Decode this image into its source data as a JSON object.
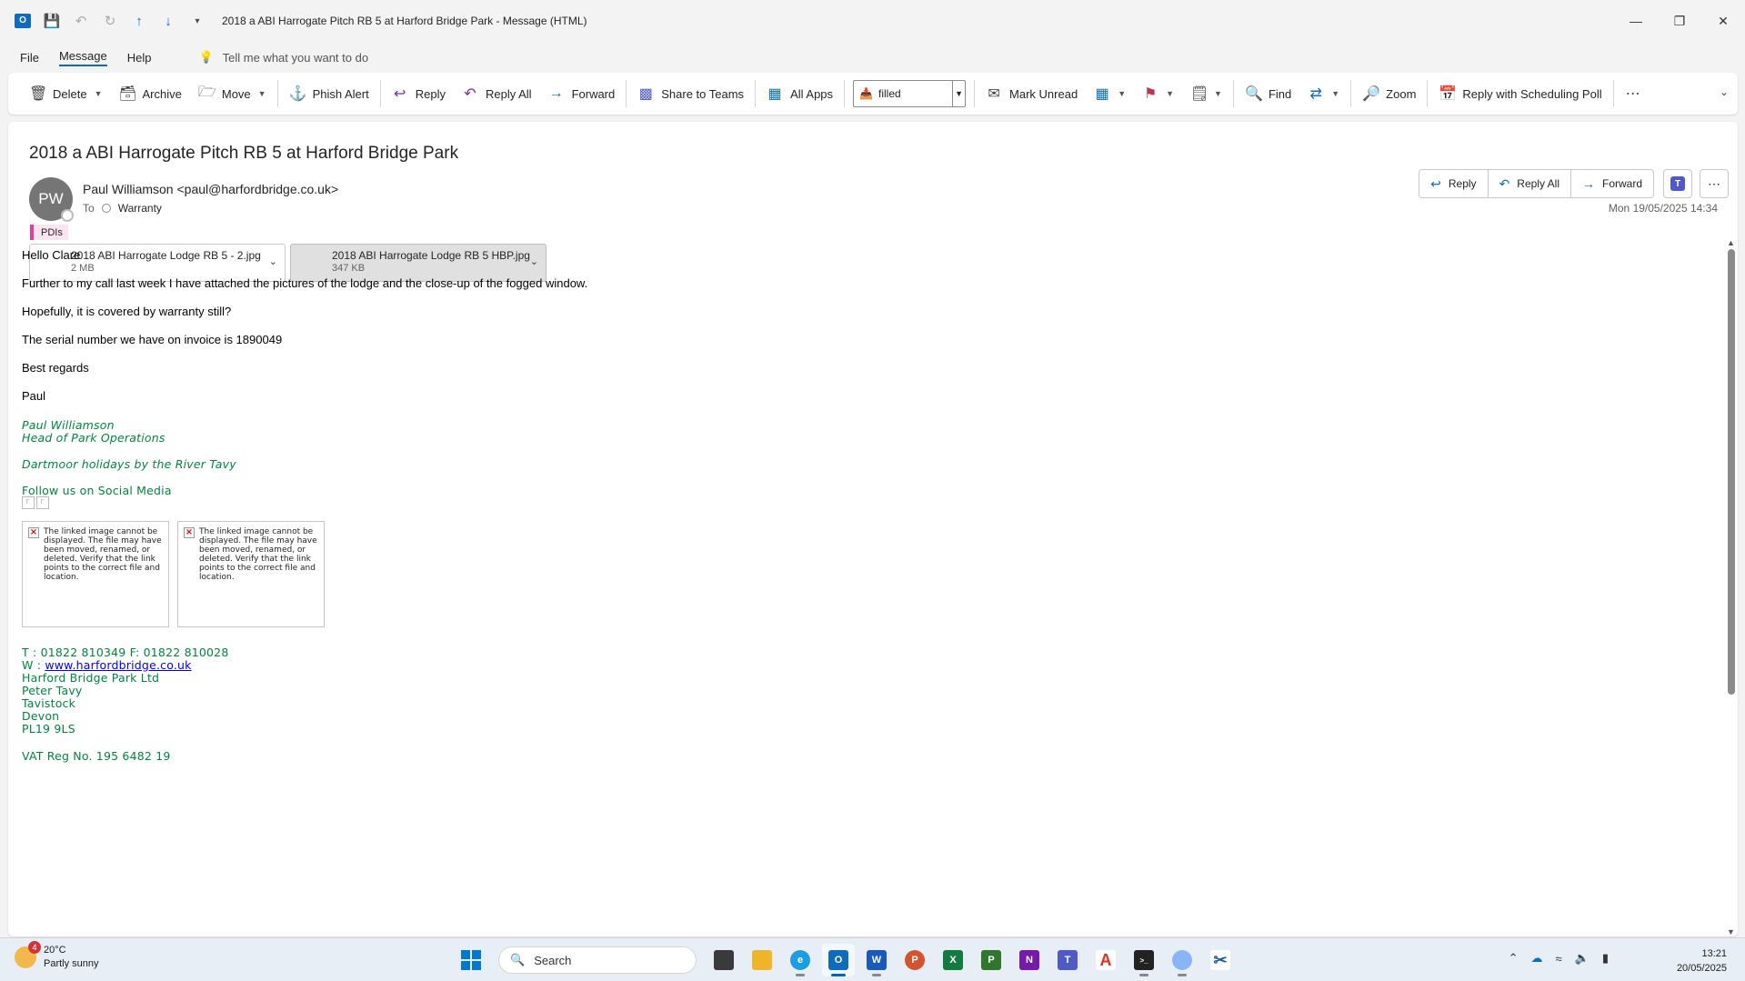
{
  "window": {
    "title": "2018 a ABI Harrogate Pitch RB 5 at Harford Bridge Park  -  Message (HTML)"
  },
  "menu": {
    "tabs": [
      "File",
      "Message",
      "Help"
    ],
    "tell_me": "Tell me what you want to do"
  },
  "ribbon": {
    "delete": "Delete",
    "archive": "Archive",
    "move": "Move",
    "phish_alert": "Phish Alert",
    "reply": "Reply",
    "reply_all": "Reply All",
    "forward": "Forward",
    "share_to_teams": "Share to Teams",
    "all_apps": "All Apps",
    "quick_steps_value": "filled",
    "mark_unread": "Mark Unread",
    "find": "Find",
    "zoom": "Zoom",
    "reply_with_scheduling_poll": "Reply with Scheduling Poll"
  },
  "message": {
    "subject": "2018 a ABI Harrogate Pitch RB 5 at Harford Bridge Park",
    "avatar_initials": "PW",
    "sender": "Paul Williamson <paul@harfordbridge.co.uk>",
    "to_label": "To",
    "recipient": "Warranty",
    "category": "PDIs",
    "category_color": "#e43ba6",
    "date": "Mon 19/05/2025 14:34",
    "actions": {
      "reply": "Reply",
      "reply_all": "Reply All",
      "forward": "Forward"
    },
    "attachments": [
      {
        "name": "2018 ABI Harrogate Lodge RB 5 - 2.jpg",
        "size": "2 MB"
      },
      {
        "name": "2018 ABI Harrogate Lodge RB 5 HBP.jpg",
        "size": "347 KB"
      }
    ],
    "body": {
      "greeting": "Hello Clare",
      "line1": "Further to my call last week I have attached the pictures of the lodge and the close-up of the fogged window.",
      "line2": "Hopefully, it is covered by warranty still?",
      "line3": "The serial number we have on invoice is 1890049",
      "closing": "Best regards",
      "name": "Paul"
    },
    "signature": {
      "name": "Paul Williamson",
      "role": "Head of Park Operations",
      "tagline": "Dartmoor holidays by the River Tavy",
      "social": "Follow us on Social Media",
      "broken_image_text": "The linked image cannot be displayed.  The file may have been moved, renamed, or deleted. Verify that the link points to the correct file and location.",
      "phone_line": "T : 01822 810349   F: 01822 810028",
      "web_prefix": "W : ",
      "web_link": "www.harfordbridge.co.uk",
      "company": "Harford Bridge Park Ltd",
      "addr1": "Peter Tavy",
      "addr2": "Tavistock",
      "addr3": "Devon",
      "postcode": "PL19 9LS",
      "vat": "VAT Reg No. 195 6482 19",
      "color": "#00853f"
    }
  },
  "taskbar": {
    "weather_temp": "20°C",
    "weather_desc": "Partly sunny",
    "weather_badge": "4",
    "search_placeholder": "Search",
    "time": "13:21",
    "date": "20/05/2025"
  }
}
